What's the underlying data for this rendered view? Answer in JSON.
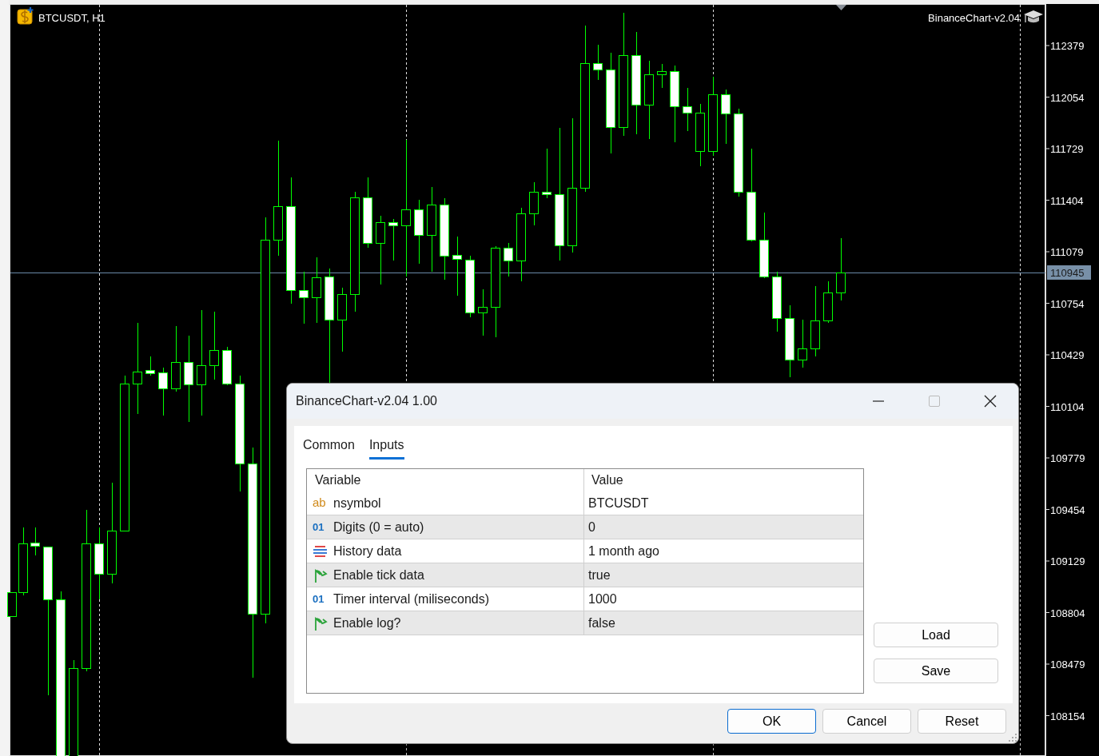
{
  "chart": {
    "symbol_label": "BTCUSDT, H1",
    "indicator_label": "BinanceChart-v2.04",
    "price_axis": [
      "112379",
      "112054",
      "111729",
      "111404",
      "111079",
      "110754",
      "110429",
      "110104",
      "109779",
      "109454",
      "109129",
      "108804",
      "108479",
      "108154"
    ],
    "current_price": "110945"
  },
  "dialog": {
    "title": "BinanceChart-v2.04 1.00",
    "tabs": [
      {
        "label": "Common",
        "selected": false
      },
      {
        "label": "Inputs",
        "selected": true
      }
    ],
    "table": {
      "columns": [
        "Variable",
        "Value"
      ],
      "rows": [
        {
          "kind": "text",
          "badge": "ab",
          "variable": "nsymbol",
          "value": "BTCUSDT"
        },
        {
          "kind": "number",
          "badge": "01",
          "variable": "Digits (0 = auto)",
          "value": "0"
        },
        {
          "kind": "list",
          "variable": "History data",
          "value": "1 month ago"
        },
        {
          "kind": "switch",
          "variable": "Enable tick data",
          "value": "true"
        },
        {
          "kind": "number",
          "badge": "01",
          "variable": "Timer interval (miliseconds)",
          "value": "1000"
        },
        {
          "kind": "switch",
          "variable": "Enable log?",
          "value": "false"
        }
      ]
    },
    "side_buttons": [
      "Load",
      "Save"
    ],
    "footer_buttons": [
      {
        "label": "OK",
        "default": true
      },
      {
        "label": "Cancel",
        "default": false
      },
      {
        "label": "Reset",
        "default": false
      }
    ]
  }
}
